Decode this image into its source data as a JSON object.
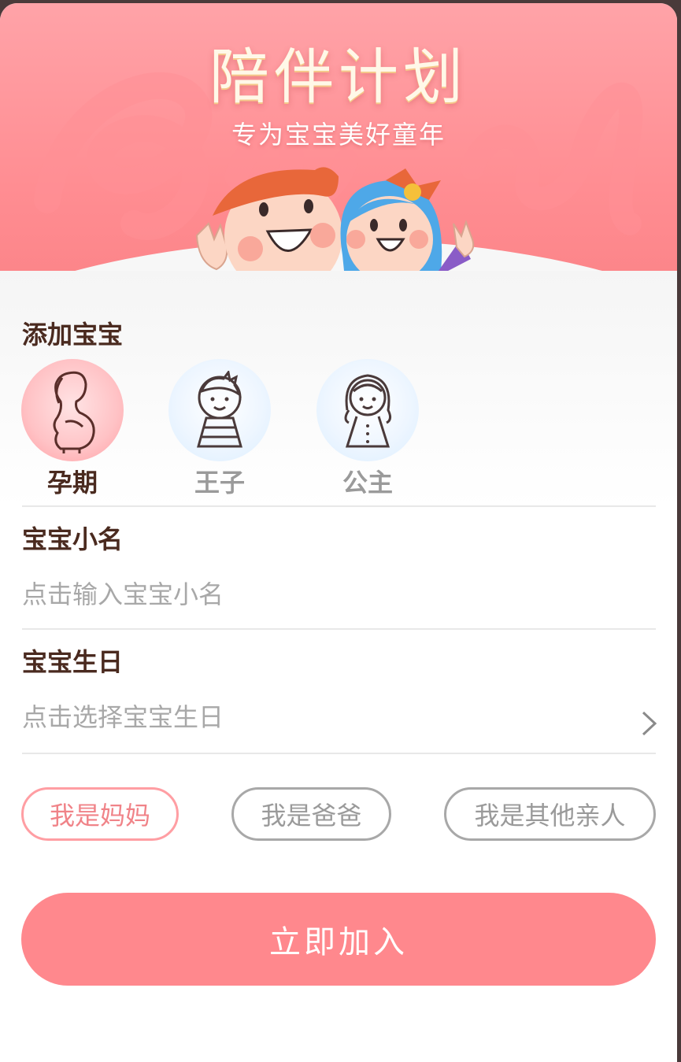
{
  "banner": {
    "title": "陪伴计划",
    "subtitle": "专为宝宝美好童年",
    "illustration": "boy-and-girl-waving"
  },
  "add_baby": {
    "title": "添加宝宝",
    "options": [
      {
        "label": "孕期",
        "icon": "pregnant-mother-icon",
        "selected": true
      },
      {
        "label": "王子",
        "icon": "boy-icon",
        "selected": false
      },
      {
        "label": "公主",
        "icon": "girl-icon",
        "selected": false
      }
    ]
  },
  "name_field": {
    "label": "宝宝小名",
    "placeholder": "点击输入宝宝小名",
    "value": ""
  },
  "birthday_field": {
    "label": "宝宝生日",
    "placeholder": "点击选择宝宝生日",
    "value": ""
  },
  "roles": [
    {
      "label": "我是妈妈",
      "selected": true
    },
    {
      "label": "我是爸爸",
      "selected": false
    },
    {
      "label": "我是其他亲人",
      "selected": false
    }
  ],
  "submit_label": "立即加入",
  "colors": {
    "accent": "#ff888d",
    "banner": "#ff9ca1",
    "heading": "#4a2a1f",
    "muted": "#a8a8a8"
  }
}
